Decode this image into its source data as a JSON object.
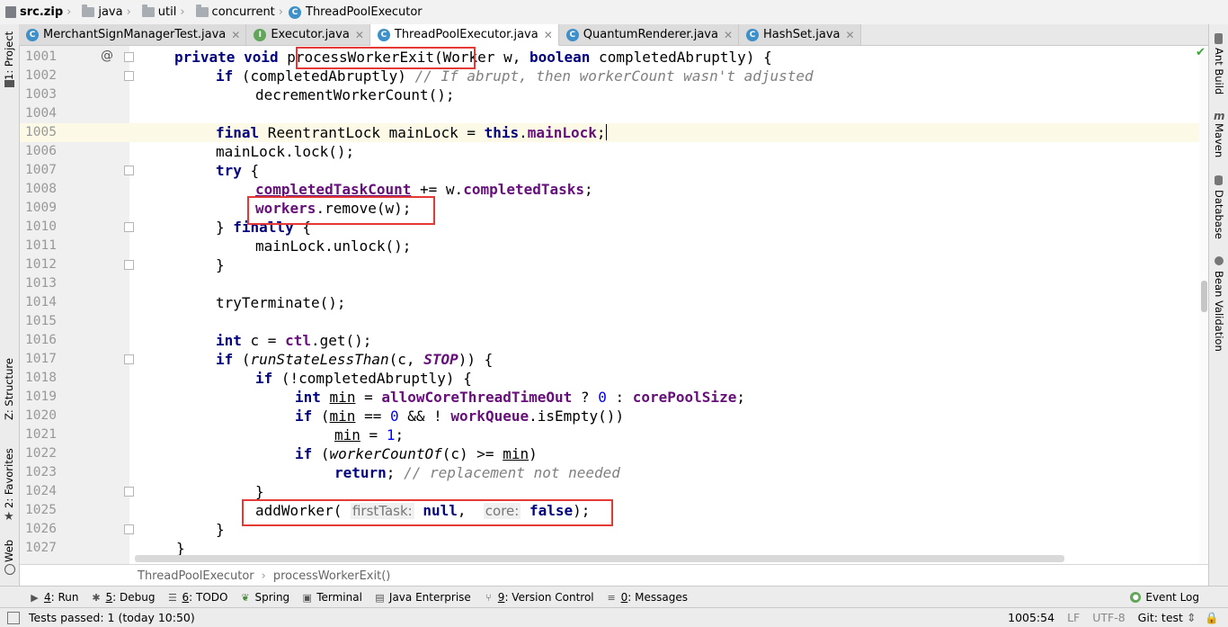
{
  "nav": {
    "items": [
      "src.zip",
      "java",
      "util",
      "concurrent",
      "ThreadPoolExecutor"
    ]
  },
  "tabs": [
    {
      "label": "MerchantSignManagerTest.java",
      "icon": "c-class-icon",
      "active": false
    },
    {
      "label": "Executor.java",
      "icon": "interface-icon",
      "active": false
    },
    {
      "label": "ThreadPoolExecutor.java",
      "icon": "c-class-icon",
      "active": true
    },
    {
      "label": "QuantumRenderer.java",
      "icon": "c-class-icon",
      "active": false
    },
    {
      "label": "HashSet.java",
      "icon": "c-class-icon",
      "active": false
    }
  ],
  "left_tools": {
    "project": "1: Project",
    "structure": "Z: Structure",
    "favorites": "2: Favorites",
    "web": "Web"
  },
  "right_tools": {
    "ant": "Ant Build",
    "maven": "Maven",
    "database": "Database",
    "bean": "Bean Validation"
  },
  "editor": {
    "line_numbers": [
      "1001",
      "1002",
      "1003",
      "1004",
      "1005",
      "1006",
      "1007",
      "1008",
      "1009",
      "1010",
      "1011",
      "1012",
      "1013",
      "1014",
      "1015",
      "1016",
      "1017",
      "1018",
      "1019",
      "1020",
      "1021",
      "1022",
      "1023",
      "1024",
      "1025",
      "1026",
      "1027"
    ],
    "gutter_annotation": "@",
    "caret_line": "1005",
    "hints": {
      "first_task": "firstTask:",
      "core": "core:"
    },
    "tokens": {
      "private": "private",
      "void": "void",
      "method_name": "processWorkerExit",
      "worker_param": "(Worker w, ",
      "boolean": "boolean",
      "param2": " completedAbruptly) {",
      "if": "if",
      "l2_rest": " (completedAbruptly) ",
      "l2_comment": "// If abrupt, then workerCount wasn't adjusted",
      "l3": "decrementWorkerCount();",
      "final": "final",
      "l5_type": " ReentrantLock mainLock = ",
      "this": "this",
      "l5_dot": ".",
      "mainlock_field": "mainLock",
      "l5_end": ";",
      "l6": "mainLock.lock();",
      "try": "try",
      "l7_end": " {",
      "completed_task_count": "completedTaskCount",
      "l8_mid": " += w.",
      "completed_tasks": "completedTasks",
      "semi": ";",
      "workers": "workers",
      "l9_rest": ".remove(w);",
      "l10_start": "} ",
      "finally": "finally",
      "l10_end": " {",
      "l11": "mainLock.unlock();",
      "close_brace": "}",
      "l14": "tryTerminate();",
      "int": "int",
      "l16_mid": " c = ",
      "ctl": "ctl",
      "l16_end": ".get();",
      "l17_open": " (",
      "run_state_less_than": "runStateLessThan",
      "l17_mid": "(c, ",
      "stop": "STOP",
      "l17_end": ")) {",
      "l18_rest": " (!completedAbruptly) {",
      "min": "min",
      "eq": " = ",
      "allow_core": "allowCoreThreadTimeOut",
      "q": " ? ",
      "zero": "0",
      "colon": " : ",
      "core_pool_size": "corePoolSize",
      "l20_open": " (",
      "l20_mid": " == ",
      "l20_and": " && ! ",
      "work_queue": "workQueue",
      "l20_end": ".isEmpty())",
      "one": "1",
      "worker_count_of": "workerCountOf",
      "l22_mid": "(c) >= ",
      "l22_end": ")",
      "return": "return",
      "l23_comment": "// replacement not needed",
      "add_worker": "addWorker(",
      "null": "null",
      "comma": ",",
      "false": "false",
      "l25_end": ");"
    }
  },
  "code_breadcrumb": [
    "ThreadPoolExecutor",
    "processWorkerExit()"
  ],
  "tool_windows": [
    {
      "key": "4",
      "label": ": Run"
    },
    {
      "key": "5",
      "label": ": Debug"
    },
    {
      "key": "6",
      "label": ": TODO"
    },
    {
      "key": "",
      "label": "Spring"
    },
    {
      "key": "",
      "label": "Terminal"
    },
    {
      "key": "",
      "label": "Java Enterprise"
    },
    {
      "key": "9",
      "label": ": Version Control"
    },
    {
      "key": "0",
      "label": ": Messages"
    }
  ],
  "event_log": "Event Log",
  "status": {
    "tests": "Tests passed: 1 (today 10:50)",
    "position": "1005:54",
    "line_sep": "LF",
    "encoding": "UTF-8",
    "vcs": "Git: test"
  }
}
